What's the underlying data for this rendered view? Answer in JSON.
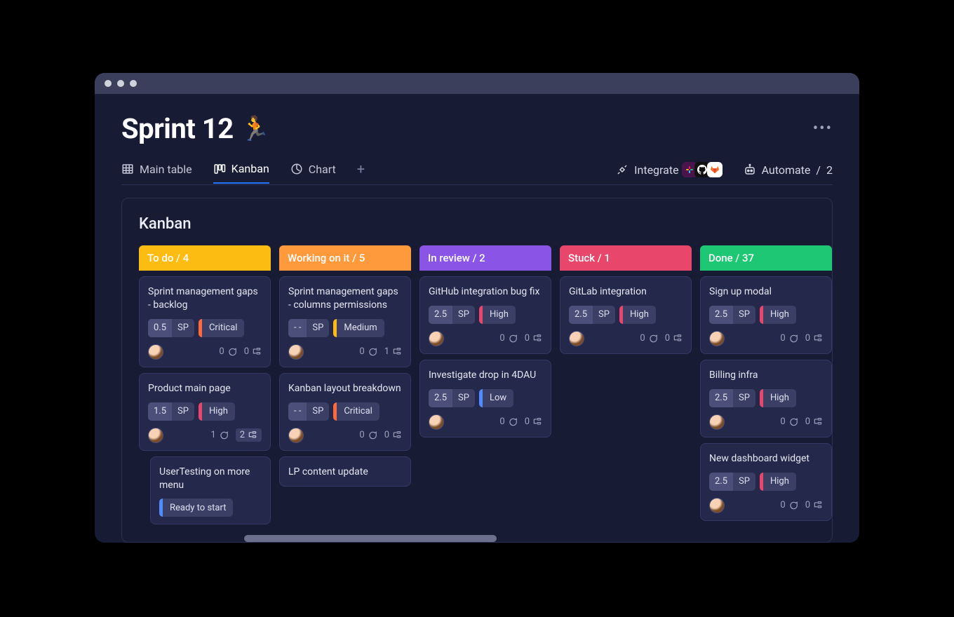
{
  "window": {
    "title": "Sprint 12",
    "title_emoji": "🏃"
  },
  "tabs": {
    "main_table": "Main table",
    "kanban": "Kanban",
    "chart": "Chart"
  },
  "toolbar": {
    "integrate": "Integrate",
    "automate": "Automate",
    "automate_count": "2"
  },
  "panel": {
    "title": "Kanban"
  },
  "columns": {
    "todo": {
      "label": "To do",
      "count": "4",
      "color": "#fdbc11"
    },
    "working": {
      "label": "Working on it",
      "count": "5",
      "color": "#ff9a3c"
    },
    "review": {
      "label": "In review",
      "count": "2",
      "color": "#8a55e6"
    },
    "stuck": {
      "label": "Stuck",
      "count": "1",
      "color": "#e8466a"
    },
    "done": {
      "label": "Done ",
      "count": "37",
      "color": "#1ec773"
    }
  },
  "labels": {
    "sp": "SP"
  },
  "priority_colors": {
    "Critical": "#ff6a3d",
    "High": "#e8466a",
    "Medium": "#fdbc11",
    "Low": "#4f8cff",
    "Ready to start": "#4f8cff"
  },
  "cards": {
    "todo": [
      {
        "title": "Sprint management gaps - backlog",
        "sp": "0.5",
        "priority": "Critical",
        "comments": "0",
        "sub": "0"
      },
      {
        "title": "Product main page",
        "sp": "1.5",
        "priority": "High",
        "comments": "1",
        "sub": "2",
        "sub_pill": true
      },
      {
        "title": "UserTesting on more menu",
        "status": "Ready to start",
        "nested": true
      }
    ],
    "working": [
      {
        "title": "Sprint management gaps - columns permissions",
        "sp": "- -",
        "priority": "Medium",
        "comments": "0",
        "sub": "1"
      },
      {
        "title": "Kanban layout breakdown",
        "sp": "- -",
        "priority": "Critical",
        "comments": "0",
        "sub": "0"
      },
      {
        "title": "LP content update",
        "partial": true
      }
    ],
    "review": [
      {
        "title": "GitHub integration bug fix",
        "sp": "2.5",
        "priority": "High",
        "comments": "0",
        "sub": "0"
      },
      {
        "title": "Investigate drop in 4DAU",
        "sp": "2.5",
        "priority": "Low",
        "comments": "0",
        "sub": "0"
      }
    ],
    "stuck": [
      {
        "title": "GitLab integration",
        "sp": "2.5",
        "priority": "High",
        "comments": "0",
        "sub": "0"
      }
    ],
    "done": [
      {
        "title": "Sign up modal",
        "sp": "2.5",
        "priority": "High",
        "comments": "0",
        "sub": "0"
      },
      {
        "title": "Billing infra",
        "sp": "2.5",
        "priority": "High",
        "comments": "0",
        "sub": "0"
      },
      {
        "title": "New dashboard widget",
        "sp": "2.5",
        "priority": "High",
        "comments": "0",
        "sub": "0"
      }
    ]
  }
}
